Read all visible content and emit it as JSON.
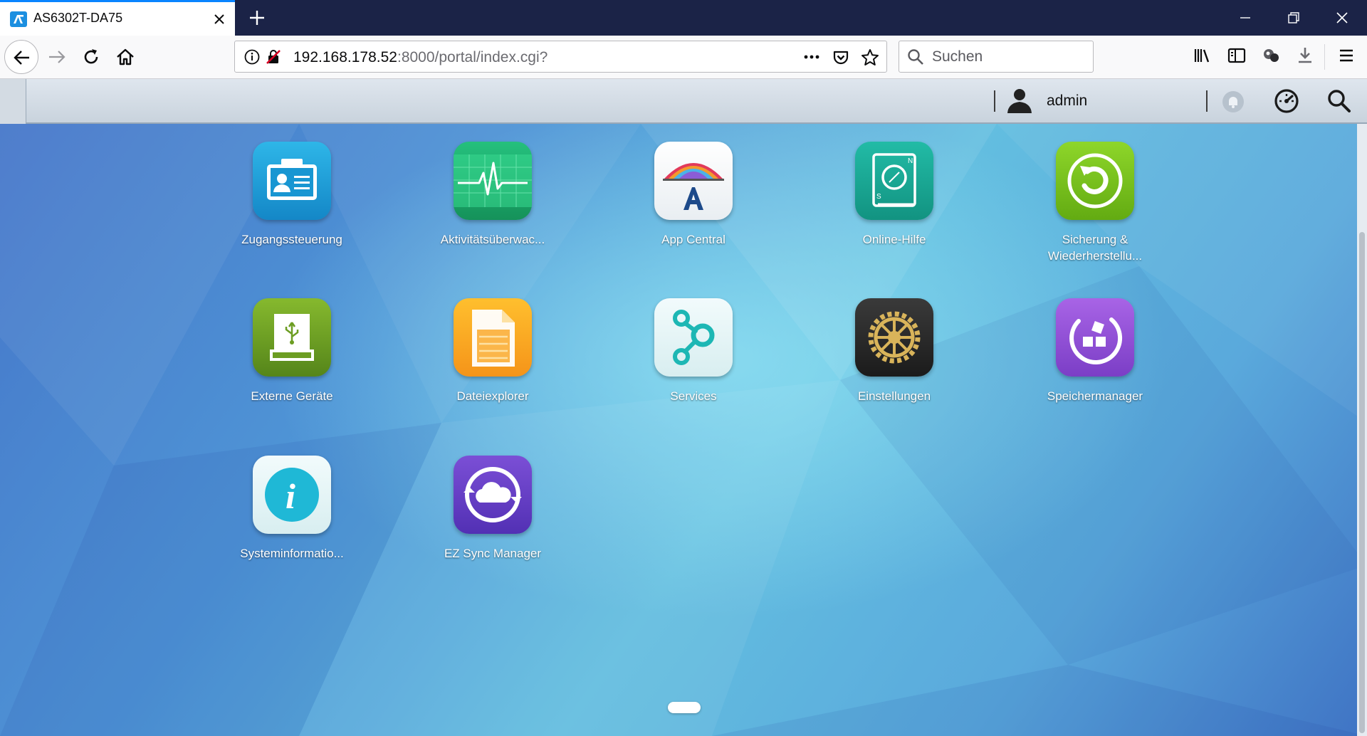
{
  "browser": {
    "tab": {
      "title": "AS6302T-DA75",
      "favicon": "asustor-adm-logo"
    },
    "new_tab": "plus-icon",
    "url": {
      "host": "192.168.178.52",
      "rest": ":8000/portal/index.cgi?"
    },
    "search": {
      "placeholder": "Suchen"
    },
    "toolbar_icons": [
      "library-icon",
      "sidebar-icon",
      "extension-icon",
      "download-icon",
      "menu-icon"
    ]
  },
  "portal": {
    "header": {
      "username": "admin"
    },
    "apps": [
      {
        "label": "Zugangssteuerung",
        "icon": "access-control-icon",
        "color": "#1b9ad1"
      },
      {
        "label": "Aktivitätsüberwac...",
        "icon": "activity-monitor-icon",
        "color": "#1fa56a"
      },
      {
        "label": "App Central",
        "icon": "app-central-icon",
        "color": "#ffffff"
      },
      {
        "label": "Online-Hilfe",
        "icon": "online-help-icon",
        "color": "#16a592"
      },
      {
        "label": "Sicherung &",
        "label2": "Wiederherstellu...",
        "icon": "backup-restore-icon",
        "color": "#7cc520"
      },
      {
        "label": "Externe Geräte",
        "icon": "external-devices-icon",
        "color": "#6c9d22"
      },
      {
        "label": "Dateiexplorer",
        "icon": "file-explorer-icon",
        "color": "#f7a823"
      },
      {
        "label": "Services",
        "icon": "services-icon",
        "color": "#e7f4f5"
      },
      {
        "label": "Einstellungen",
        "icon": "settings-icon",
        "color": "#2b2b2b"
      },
      {
        "label": "Speichermanager",
        "icon": "storage-manager-icon",
        "color": "#9553d6"
      },
      {
        "label": "Systeminformatio...",
        "icon": "system-info-icon",
        "color": "#e7f4f5"
      },
      {
        "label": "EZ Sync Manager",
        "icon": "ez-sync-icon",
        "color": "#6b3fc4"
      }
    ]
  }
}
